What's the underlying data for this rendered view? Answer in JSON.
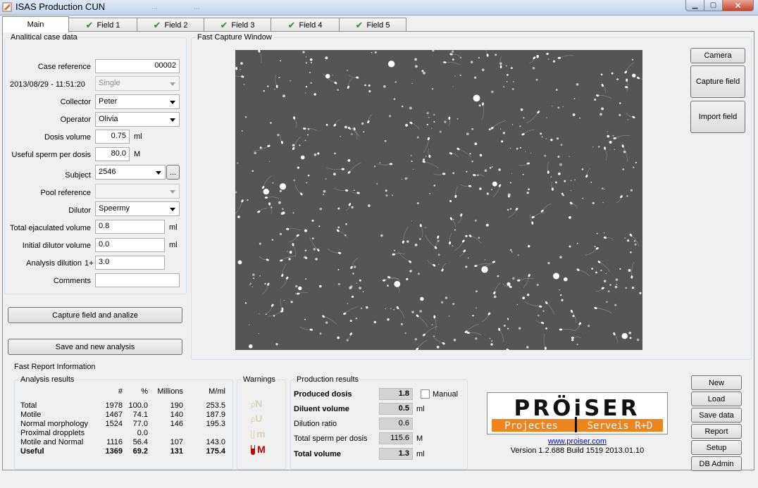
{
  "window": {
    "title": "ISAS Production CUN",
    "menu_ghost": [
      "...",
      "...",
      "..."
    ],
    "min_icon": "minimize-icon",
    "max_icon": "maximize-icon",
    "close_icon": "close-icon"
  },
  "tabs": [
    {
      "label": "Main",
      "active": true
    },
    {
      "label": "Field 1",
      "checked": true
    },
    {
      "label": "Field 2",
      "checked": true
    },
    {
      "label": "Field 3",
      "checked": true
    },
    {
      "label": "Field 4",
      "checked": true
    },
    {
      "label": "Field 5",
      "checked": true
    }
  ],
  "case": {
    "group_title": "Analitical case data",
    "case_reference_label": "Case reference",
    "case_reference": "00002",
    "datetime": "2013/08/29 - 11:51:20",
    "mode": "Single",
    "collector_label": "Collector",
    "collector": "Peter",
    "operator_label": "Operator",
    "operator": "Olivia",
    "dosis_volume_label": "Dosis volume",
    "dosis_volume": "0.75",
    "dosis_volume_unit": "ml",
    "useful_sperm_label": "Useful sperm per dosis",
    "useful_sperm": "80.0",
    "useful_sperm_unit": "M",
    "subject_label": "Subject",
    "subject": "2546",
    "subject_browse": "...",
    "pool_reference_label": "Pool reference",
    "pool_reference": "",
    "dilutor_label": "Dilutor",
    "dilutor": "Speermy",
    "total_ejaculated_label": "Total ejaculated volume",
    "total_ejaculated": "0.8",
    "total_ejaculated_unit": "ml",
    "initial_dilutor_label": "Initial dilutor volume",
    "initial_dilutor": "0.0",
    "initial_dilutor_unit": "ml",
    "analysis_dilution_label": "Analysis dilution",
    "analysis_dilution_prefix": "1+",
    "analysis_dilution": "3.0",
    "comments_label": "Comments",
    "comments": ""
  },
  "actions": {
    "capture_analyze": "Capture field and analize",
    "save_new": "Save and new analysis"
  },
  "capture": {
    "group_title": "Fast Capture Window",
    "camera": "Camera",
    "capture_field": "Capture field",
    "import_field": "Import field"
  },
  "report": {
    "group_title": "Fast Report Information",
    "analysis_title": "Analysis results",
    "columns": [
      "#",
      "%",
      "Millions",
      "M/ml"
    ],
    "rows": [
      {
        "label": "Total",
        "n": "1978",
        "pct": "100.0",
        "mill": "190",
        "mml": "253.5"
      },
      {
        "label": "Motile",
        "n": "1467",
        "pct": "74.1",
        "mill": "140",
        "mml": "187.9"
      },
      {
        "label": "Normal morphology",
        "n": "1524",
        "pct": "77.0",
        "mill": "146",
        "mml": "195.3"
      },
      {
        "label": "Proximal dropplets",
        "n": "",
        "pct": "0.0",
        "mill": "",
        "mml": ""
      },
      {
        "label": "Motile and Normal",
        "n": "1116",
        "pct": "56.4",
        "mill": "107",
        "mml": "143.0"
      },
      {
        "label": "Useful",
        "n": "1369",
        "pct": "69.2",
        "mill": "131",
        "mml": "175.4",
        "bold": true
      }
    ],
    "warnings_title": "Warnings",
    "warnings": [
      {
        "letter": "N",
        "icon": "sperm-normal-icon",
        "active": false
      },
      {
        "letter": "U",
        "icon": "sperm-useful-icon",
        "active": false
      },
      {
        "letter": "m",
        "icon": "tube-low-icon",
        "active": false
      },
      {
        "letter": "M",
        "icon": "tube-high-icon",
        "active": true
      }
    ],
    "production_title": "Production results",
    "produced_dosis_label": "Produced dosis",
    "produced_dosis": "1.8",
    "manual_label": "Manual",
    "manual_checked": false,
    "diluent_volume_label": "Diluent volume",
    "diluent_volume": "0.5",
    "diluent_volume_unit": "ml",
    "dilution_ratio_label": "Dilution ratio",
    "dilution_ratio": "0.6",
    "total_sperm_label": "Total sperm per dosis",
    "total_sperm": "115.6",
    "total_sperm_unit": "M",
    "total_volume_label": "Total volume",
    "total_volume": "1.3",
    "total_volume_unit": "ml"
  },
  "logo": {
    "main": "PRÖiSER",
    "tag_left": "Projectes",
    "tag_right": "Serveis R+D",
    "url": "www.proiser.com",
    "version": "Version 1.2.688 Build 1519 2013.01.10",
    "colors": {
      "orange": "#f0841c",
      "dark": "#111111"
    }
  },
  "side_buttons": [
    "New",
    "Load",
    "Save data",
    "Report",
    "Setup",
    "DB Admin"
  ],
  "colors": {
    "capture_background": "#555555",
    "warning_active": "#c00000",
    "warning_inactive": "#d8d2b8"
  }
}
